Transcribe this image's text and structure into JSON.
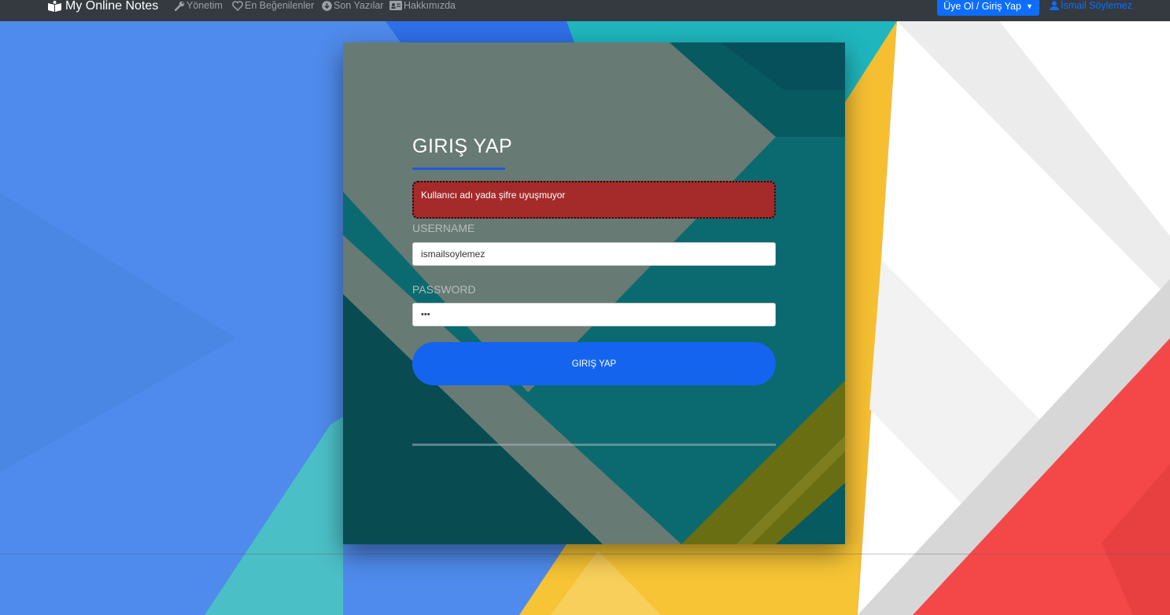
{
  "navbar": {
    "brand": "My Online Notes",
    "links": [
      {
        "label": "Yönetim",
        "icon": "wrench-icon"
      },
      {
        "label": "En Beğenilenler",
        "icon": "heart-icon"
      },
      {
        "label": "Son Yazılar",
        "icon": "arrow-circle-down-icon"
      },
      {
        "label": "Hakkımızda",
        "icon": "id-card-icon"
      }
    ],
    "account_dropdown": "Üye Ol / Giriş Yap",
    "user_name": "İsmail Söylemez"
  },
  "login": {
    "title": "GIRIŞ YAP",
    "error": "Kullanıcı adı yada şifre uyuşmuyor",
    "username_label": "USERNAME",
    "username_value": "ismailsoylemez",
    "password_label": "PASSWORD",
    "password_value": "•••",
    "submit_label": "GIRIŞ YAP"
  },
  "colors": {
    "navbar": "#343a40",
    "primary": "#0d6efd",
    "alert": "#a52a2a",
    "card_gray": "#687a74",
    "card_teal": "#0b6a6f"
  }
}
